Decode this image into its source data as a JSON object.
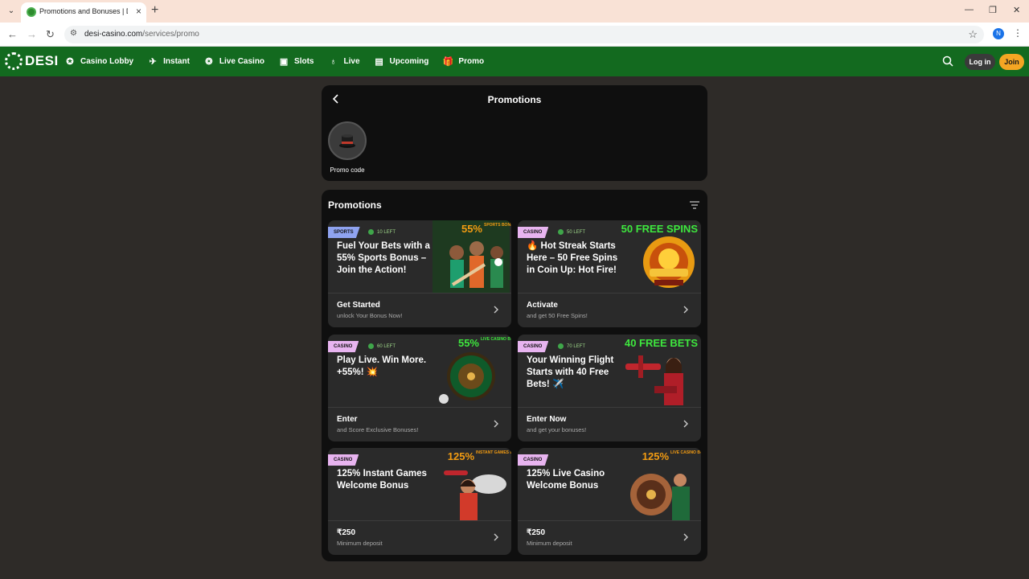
{
  "browser": {
    "tab_title": "Promotions and Bonuses | Desi",
    "url_host": "desi-casino.com",
    "url_path": "/services/promo",
    "profile_initial": "N"
  },
  "site": {
    "logo_text": "DESI",
    "nav": [
      {
        "label": "Casino Lobby",
        "icon": "casino-chip-icon"
      },
      {
        "label": "Instant",
        "icon": "plane-icon"
      },
      {
        "label": "Live Casino",
        "icon": "roulette-icon"
      },
      {
        "label": "Slots",
        "icon": "slot-machine-icon"
      },
      {
        "label": "Live",
        "icon": "microphone-icon"
      },
      {
        "label": "Upcoming",
        "icon": "calendar-icon"
      },
      {
        "label": "Promo",
        "icon": "gift-icon"
      }
    ],
    "login_label": "Log in",
    "join_label": "Join",
    "accent_green": "#136a1f",
    "accent_orange": "#f5a623"
  },
  "top_panel": {
    "title": "Promotions",
    "promo_code_label": "Promo code"
  },
  "promotions": {
    "heading": "Promotions",
    "cards": [
      {
        "badge": "SPORTS",
        "left": "10 LEFT",
        "title": "Fuel Your Bets with a 55% Sports Bonus – Join the Action!",
        "art_big": "55%",
        "art_small": "SPORTS BONUS",
        "cta": "Get Started",
        "cta_sub": "unlock Your Bonus Now!"
      },
      {
        "badge": "CASINO",
        "left": "50 LEFT",
        "title": "🔥 Hot Streak Starts Here – 50 Free Spins in Coin Up: Hot Fire!",
        "art_big": "50 FREE SPINS",
        "art_small": "",
        "cta": "Activate",
        "cta_sub": "and get 50 Free Spins!"
      },
      {
        "badge": "CASINO",
        "left": "60 LEFT",
        "title": "Play Live. Win More. +55%! 💥",
        "art_big": "55%",
        "art_small": "LIVE CASINO BONUS",
        "cta": "Enter",
        "cta_sub": "and Score Exclusive Bonuses!"
      },
      {
        "badge": "CASINO",
        "left": "70 LEFT",
        "title": "Your Winning Flight Starts with 40 Free Bets! ✈️",
        "art_big": "40 FREE BETS",
        "art_small": "",
        "cta": "Enter Now",
        "cta_sub": "and get your bonuses!"
      },
      {
        "badge": "CASINO",
        "left": "",
        "title": "125% Instant Games Welcome Bonus",
        "art_big": "125%",
        "art_small": "INSTANT GAMES BONUS",
        "cta": "₹250",
        "cta_sub": "Minimum deposit"
      },
      {
        "badge": "CASINO",
        "left": "",
        "title": "125% Live Casino Welcome Bonus",
        "art_big": "125%",
        "art_small": "LIVE CASINO BONUS",
        "cta": "₹250",
        "cta_sub": "Minimum deposit"
      }
    ]
  }
}
